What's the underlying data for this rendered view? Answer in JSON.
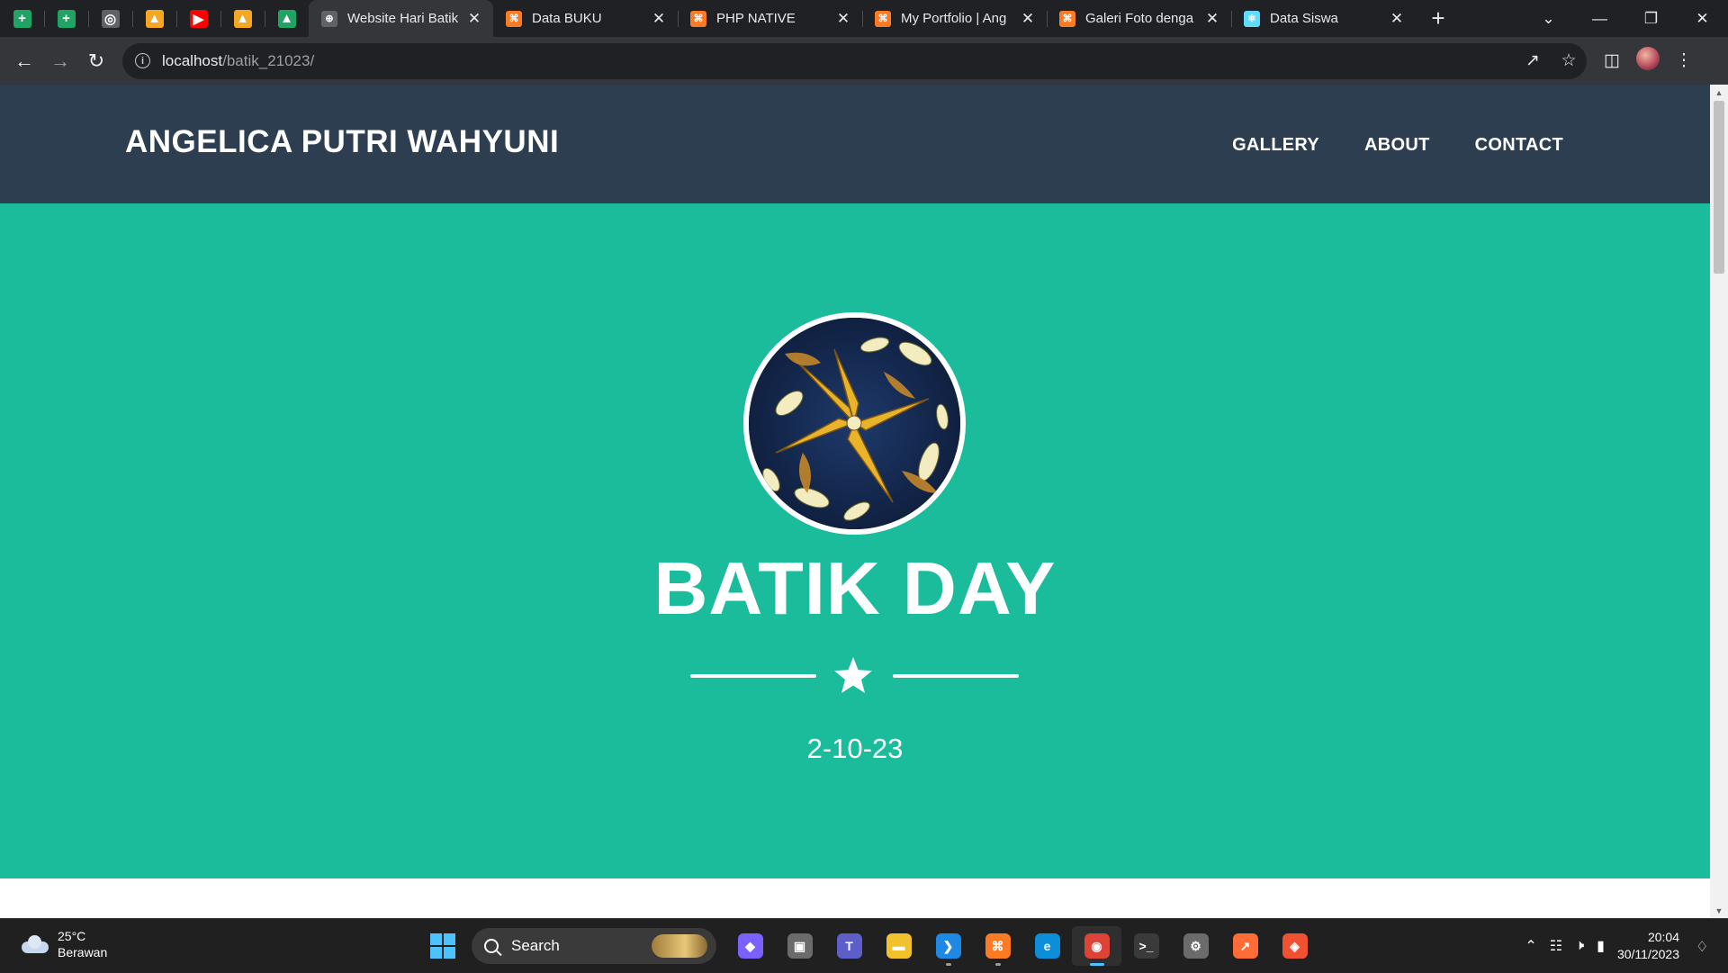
{
  "browser": {
    "pinned_tabs": [
      {
        "icon": "google-sheets-icon",
        "glyph": "+",
        "color": "#21a366"
      },
      {
        "icon": "google-sheets-icon",
        "glyph": "+",
        "color": "#21a366"
      },
      {
        "icon": "globe-icon",
        "glyph": "◎",
        "color": "#5f6368"
      },
      {
        "icon": "firebase-icon",
        "glyph": "▲",
        "color": "#f5a623"
      },
      {
        "icon": "youtube-icon",
        "glyph": "▶",
        "color": "#ff0000"
      },
      {
        "icon": "firebase-icon",
        "glyph": "▲",
        "color": "#f5a623"
      },
      {
        "icon": "google-drive-icon",
        "glyph": "▲",
        "color": "#1fa463"
      }
    ],
    "tabs": [
      {
        "title": "Website Hari Batik",
        "icon": "globe-icon",
        "glyph": "⊕",
        "color": "#5f6368",
        "active": true
      },
      {
        "title": "Data BUKU",
        "icon": "xampp-icon",
        "glyph": "⌘",
        "color": "#fb7a24",
        "active": false
      },
      {
        "title": "PHP NATIVE",
        "icon": "xampp-icon",
        "glyph": "⌘",
        "color": "#fb7a24",
        "active": false
      },
      {
        "title": "My Portfolio | Ang",
        "icon": "xampp-icon",
        "glyph": "⌘",
        "color": "#fb7a24",
        "active": false
      },
      {
        "title": "Galeri Foto denga",
        "icon": "xampp-icon",
        "glyph": "⌘",
        "color": "#fb7a24",
        "active": false
      },
      {
        "title": "Data Siswa",
        "icon": "react-icon",
        "glyph": "⚛",
        "color": "#61dafb",
        "active": false
      }
    ],
    "url_host": "localhost",
    "url_path": "/batik_21023/"
  },
  "site": {
    "brand": "ANGELICA PUTRI WAHYUNI",
    "nav": [
      "GALLERY",
      "ABOUT",
      "CONTACT"
    ],
    "hero_title": "BATIK DAY",
    "hero_date": "2-10-23",
    "colors": {
      "navbar": "#2c3e50",
      "masthead": "#1abc9c",
      "text": "#ffffff"
    }
  },
  "taskbar": {
    "weather_temp": "25°C",
    "weather_desc": "Berawan",
    "search_placeholder": "Search",
    "time": "20:04",
    "date": "30/11/2023",
    "apps": [
      {
        "name": "copilot-icon",
        "glyph": "◆",
        "color": "#7b61ff",
        "running": false
      },
      {
        "name": "task-view-icon",
        "glyph": "▣",
        "color": "#6b6b6b",
        "running": false
      },
      {
        "name": "teams-icon",
        "glyph": "T",
        "color": "#5b5fc7",
        "running": false
      },
      {
        "name": "file-explorer-icon",
        "glyph": "▬",
        "color": "#f2c12e",
        "running": false
      },
      {
        "name": "vscode-icon",
        "glyph": "❯",
        "color": "#1e88e5",
        "running": true
      },
      {
        "name": "xampp-icon",
        "glyph": "⌘",
        "color": "#fb7a24",
        "running": true
      },
      {
        "name": "edge-icon",
        "glyph": "e",
        "color": "#0c8ed9",
        "running": false
      },
      {
        "name": "chrome-icon",
        "glyph": "◉",
        "color": "#db4437",
        "running": true,
        "active": true
      },
      {
        "name": "terminal-icon",
        "glyph": ">_",
        "color": "#3a3a3a",
        "running": false
      },
      {
        "name": "settings-icon",
        "glyph": "⚙",
        "color": "#6b6b6b",
        "running": false
      },
      {
        "name": "postman-icon",
        "glyph": "↗",
        "color": "#ff6c37",
        "running": false
      },
      {
        "name": "git-icon",
        "glyph": "◈",
        "color": "#f05133",
        "running": false
      }
    ]
  }
}
